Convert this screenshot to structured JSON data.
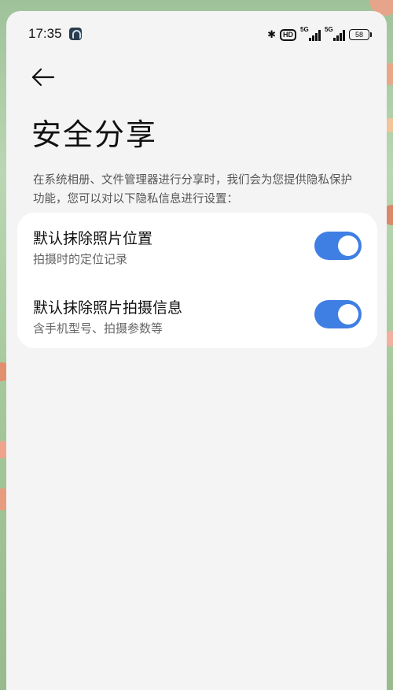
{
  "status_bar": {
    "time": "17:35",
    "hd_label": "HD",
    "signal_1_label": "5G",
    "signal_2_label": "5G",
    "battery": "58"
  },
  "page": {
    "title": "安全分享",
    "description": "在系统相册、文件管理器进行分享时，我们会为您提供隐私保护功能，您可以对以下隐私信息进行设置："
  },
  "settings": [
    {
      "title": "默认抹除照片位置",
      "subtitle": "拍摄时的定位记录",
      "enabled": true
    },
    {
      "title": "默认抹除照片拍摄信息",
      "subtitle": "含手机型号、拍摄参数等",
      "enabled": true
    }
  ],
  "colors": {
    "accent": "#3f7fe3",
    "card_bg": "#ffffff",
    "page_bg": "#f4f4f4"
  },
  "icons": {
    "back": "arrow-left-icon",
    "bluetooth": "bluetooth-icon"
  }
}
